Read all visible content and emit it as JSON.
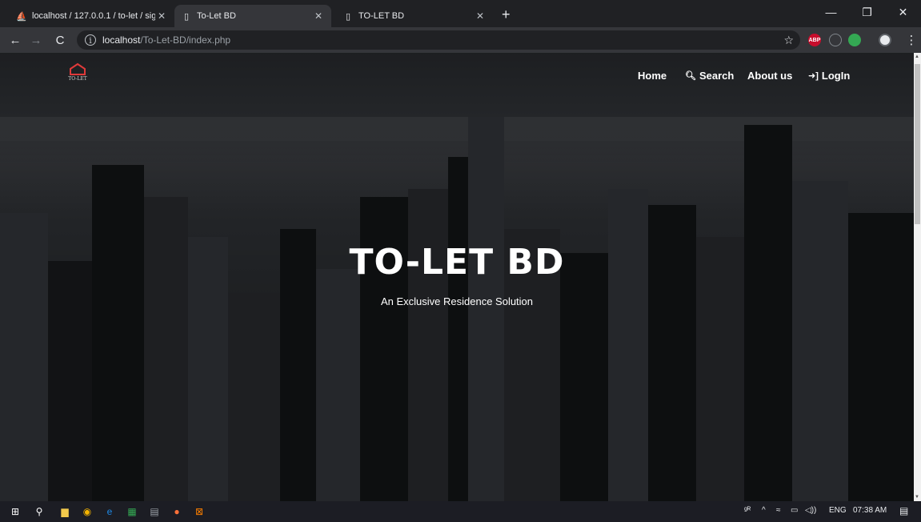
{
  "browser": {
    "tabs": [
      {
        "title": "localhost / 127.0.0.1 / to-let / sig",
        "icon": "phpmyadmin-icon"
      },
      {
        "title": "To-Let BD",
        "icon": "page-icon"
      },
      {
        "title": "TO-LET BD",
        "icon": "page-icon"
      }
    ],
    "new_tab_label": "+",
    "url_host": "localhost",
    "url_path": "/To-Let-BD/index.php",
    "extensions": [
      {
        "name": "adblock-plus-icon",
        "label": "ABP",
        "color": "#c70d2c"
      }
    ]
  },
  "site": {
    "logo_text": "TO-LET",
    "nav": [
      {
        "label": "Home",
        "icon": ""
      },
      {
        "label": "Search",
        "icon": "search-icon"
      },
      {
        "label": "About us",
        "icon": ""
      },
      {
        "label": "LogIn",
        "icon": "login-icon"
      }
    ],
    "hero_title": "TO-LET BD",
    "hero_subtitle": "An Exclusive Residence Solution"
  },
  "taskbar": {
    "language": "ENG",
    "time": "07:38 AM"
  },
  "colors": {
    "logo_accent": "#e03a3a",
    "chrome_dark": "#202124",
    "chrome_toolbar": "#35363a"
  }
}
